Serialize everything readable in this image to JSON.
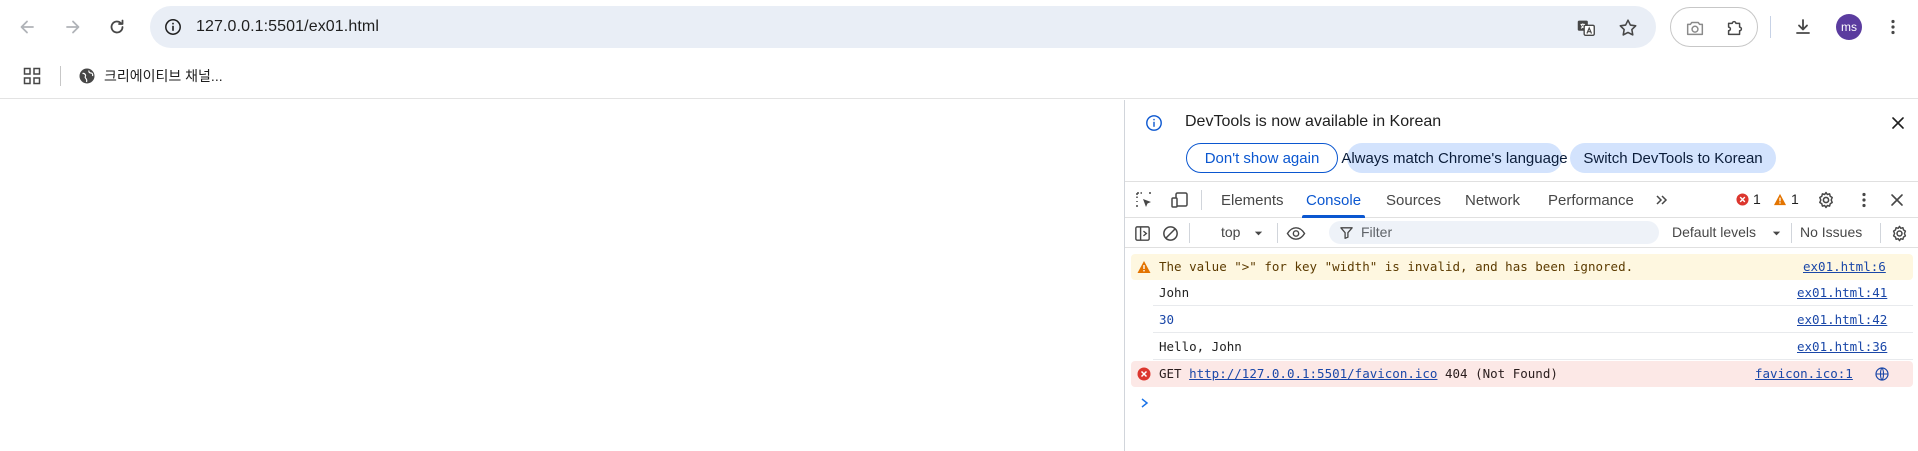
{
  "browser": {
    "url": "127.0.0.1:5501/ex01.html",
    "avatar_initials": "ms",
    "back_label": "Back",
    "forward_label": "Forward",
    "reload_label": "Reload"
  },
  "bookmarks": {
    "items": [
      {
        "label": "크리에이티브 채널...",
        "icon": "globe-icon"
      }
    ]
  },
  "devtools": {
    "infobar": {
      "message": "DevTools is now available in Korean",
      "buttons": {
        "dont_show": "Don't show again",
        "always_match": "Always match Chrome's language",
        "switch": "Switch DevTools to Korean"
      }
    },
    "tabs": [
      "Elements",
      "Console",
      "Sources",
      "Network",
      "Performance"
    ],
    "active_tab": "Console",
    "error_count": "1",
    "warning_count": "1",
    "filterbar": {
      "context": "top",
      "filter_placeholder": "Filter",
      "levels": "Default levels",
      "issues": "No Issues"
    },
    "console": {
      "messages": [
        {
          "level": "warning",
          "text": "The value \">\" for key \"width\" is invalid, and has been ignored.",
          "source": "ex01.html:6"
        },
        {
          "level": "log",
          "text": "John",
          "source": "ex01.html:41"
        },
        {
          "level": "log",
          "text": "30",
          "source": "ex01.html:42"
        },
        {
          "level": "log",
          "text": "Hello, John",
          "source": "ex01.html:36"
        },
        {
          "level": "error",
          "method": "GET",
          "link": "http://127.0.0.1:5501/favicon.ico",
          "status": "404 (Not Found)",
          "source": "favicon.ico:1"
        }
      ]
    }
  },
  "colors": {
    "accent": "#0b57d0",
    "warning_bg": "#fef7e0",
    "error_bg": "#fce8e6",
    "avatar": "#5b3c9f"
  }
}
